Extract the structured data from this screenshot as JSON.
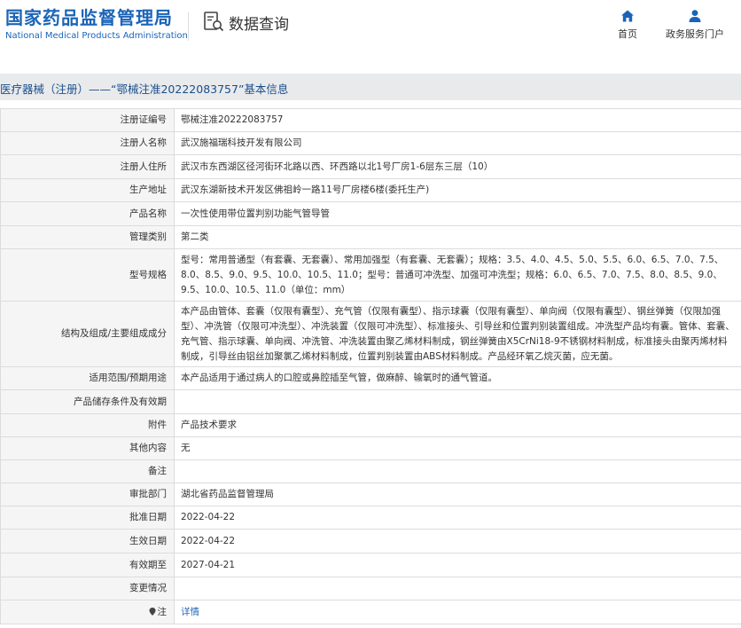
{
  "header": {
    "logo_cn": "国家药品监督管理局",
    "logo_en": "National Medical Products Administration",
    "query_label": "数据查询",
    "nav_home": "首页",
    "nav_service": "政务服务门户",
    "brand_color": "#1a64b8",
    "nav_icon_color": "#1a64b8"
  },
  "title": "医疗器械（注册）——“鄂械注准20222083757”基本信息",
  "rows": [
    {
      "label": "注册证编号",
      "value": "鄂械注准20222083757"
    },
    {
      "label": "注册人名称",
      "value": "武汉施福瑞科技开发有限公司"
    },
    {
      "label": "注册人住所",
      "value": "武汉市东西湖区径河街环北路以西、环西路以北1号厂房1-6层东三层（10）"
    },
    {
      "label": "生产地址",
      "value": "武汉东湖新技术开发区佛祖岭一路11号厂房楼6楼(委托生产)"
    },
    {
      "label": "产品名称",
      "value": "一次性使用带位置判别功能气管导管"
    },
    {
      "label": "管理类别",
      "value": "第二类"
    },
    {
      "label": "型号规格",
      "value": "型号：常用普通型（有套囊、无套囊）、常用加强型（有套囊、无套囊）；规格：3.5、4.0、4.5、5.0、5.5、6.0、6.5、7.0、7.5、8.0、8.5、9.0、9.5、10.0、10.5、11.0；型号：普通可冲洗型、加强可冲洗型；规格：6.0、6.5、7.0、7.5、8.0、8.5、9.0、9.5、10.0、10.5、11.0（单位：mm）"
    },
    {
      "label": "结构及组成/主要组成成分",
      "value": "本产品由管体、套囊（仅限有囊型）、充气管（仅限有囊型）、指示球囊（仅限有囊型）、单向阀（仅限有囊型）、钢丝弹簧（仅限加强型）、冲洗管（仅限可冲洗型）、冲洗装置（仅限可冲洗型）、标准接头、引导丝和位置判别装置组成。冲洗型产品均有囊。管体、套囊、充气管、指示球囊、单向阀、冲洗管、冲洗装置由聚乙烯材料制成，钢丝弹簧由X5CrNi18-9不锈钢材料制成，标准接头由聚丙烯材料制成，引导丝由铝丝加聚氯乙烯材料制成，位置判别装置由ABS材料制成。产品经环氧乙烷灭菌，应无菌。"
    },
    {
      "label": "适用范围/预期用途",
      "value": "本产品适用于通过病人的口腔或鼻腔插至气管，做麻醉、输氧时的通气管道。"
    },
    {
      "label": "产品储存条件及有效期",
      "value": ""
    },
    {
      "label": "附件",
      "value": "产品技术要求"
    },
    {
      "label": "其他内容",
      "value": "无"
    },
    {
      "label": "备注",
      "value": ""
    },
    {
      "label": "审批部门",
      "value": "湖北省药品监督管理局"
    },
    {
      "label": "批准日期",
      "value": "2022-04-22"
    },
    {
      "label": "生效日期",
      "value": "2022-04-22"
    },
    {
      "label": "有效期至",
      "value": "2027-04-21"
    },
    {
      "label": "变更情况",
      "value": ""
    },
    {
      "label": "注",
      "value": "详情",
      "link": true,
      "label_icon": "location-pin-icon"
    }
  ]
}
